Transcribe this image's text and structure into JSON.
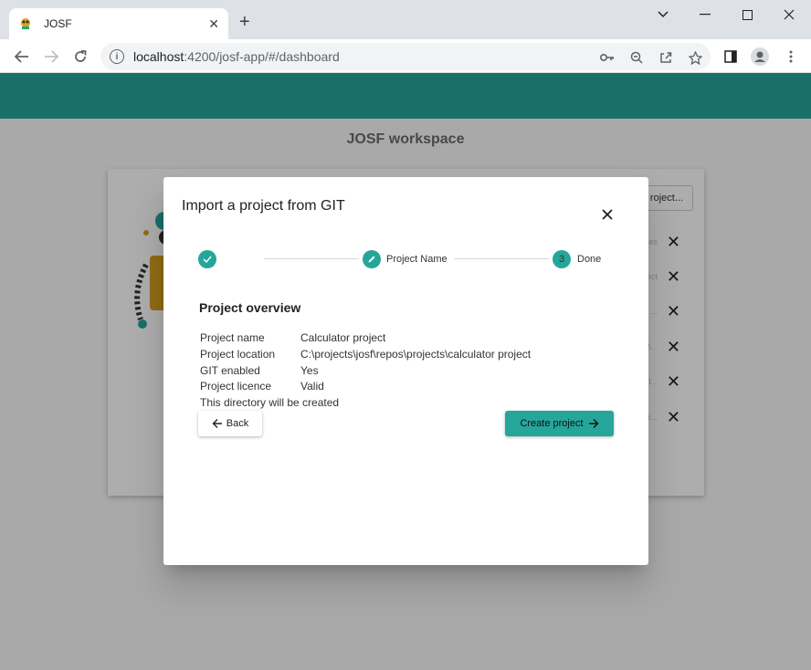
{
  "browser": {
    "tab_title": "JOSF",
    "tab_close": "✕",
    "new_tab": "+",
    "url_host": "localhost",
    "url_rest": ":4200/josf-app/#/dashboard"
  },
  "app": {
    "workspace_title": "JOSF workspace",
    "project_button_label": "roject...",
    "recent_faded": [
      "ees",
      "ject",
      "y ...",
      "\\...",
      "pl...",
      "e..."
    ]
  },
  "dialog": {
    "title": "Import a project from GIT",
    "steps": [
      {
        "number": "",
        "label": "",
        "state": "done"
      },
      {
        "number": "",
        "label": "Project Name",
        "state": "edit"
      },
      {
        "number": "3",
        "label": "Done",
        "state": "active"
      }
    ],
    "section_title": "Project overview",
    "details": [
      {
        "label": "Project name",
        "value": "Calculator project"
      },
      {
        "label": "Project location",
        "value": "C:\\projects\\josf\\repos\\projects\\calculator project"
      },
      {
        "label": "GIT enabled",
        "value": "Yes"
      },
      {
        "label": "Project licence",
        "value": "Valid"
      }
    ],
    "note": "This directory will be created",
    "back_label": "Back",
    "create_label": "Create project"
  },
  "colors": {
    "accent": "#26a69a",
    "titlebar": "#dee1e6"
  }
}
